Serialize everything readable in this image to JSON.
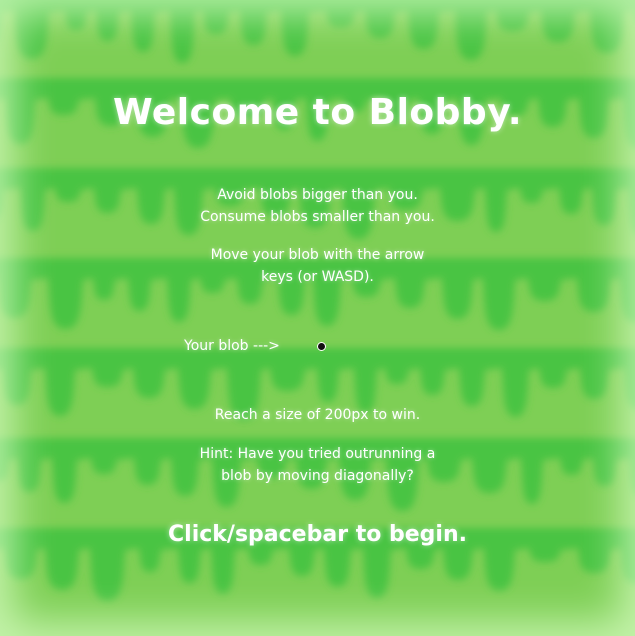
{
  "game": {
    "title": "Welcome to Blobby.",
    "rules": {
      "line1": "Avoid blobs bigger than you.",
      "line2": "Consume blobs smaller than you."
    },
    "controls": {
      "line1": "Move your blob with the arrow",
      "line2": "keys (or WASD)."
    },
    "blob_label": "Your blob --->",
    "goal": "Reach a size of 200px to win.",
    "hint": {
      "line1": "Hint: Have you tried outrunning a",
      "line2": "blob by moving diagonally?"
    },
    "start_prompt": "Click/spacebar to begin."
  },
  "colors": {
    "background": "#7ecf55",
    "slime_dark": "#3fc23f",
    "slime_mid": "#55c84a",
    "text": "#ffffff",
    "player_blob": "#111111"
  }
}
